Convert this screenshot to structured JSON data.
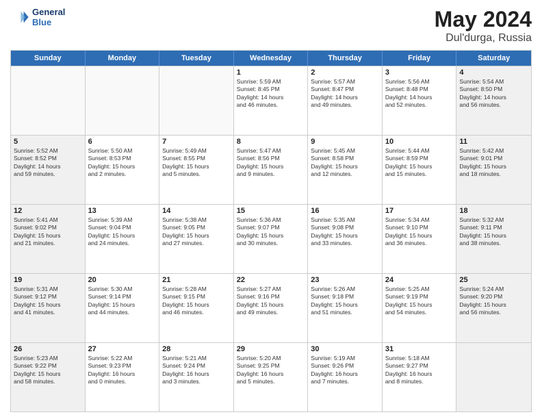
{
  "logo": {
    "line1": "General",
    "line2": "Blue"
  },
  "title": "May 2024",
  "location": "Dul'durga, Russia",
  "weekdays": [
    "Sunday",
    "Monday",
    "Tuesday",
    "Wednesday",
    "Thursday",
    "Friday",
    "Saturday"
  ],
  "rows": [
    [
      {
        "day": "",
        "info": "",
        "empty": true
      },
      {
        "day": "",
        "info": "",
        "empty": true
      },
      {
        "day": "",
        "info": "",
        "empty": true
      },
      {
        "day": "1",
        "info": "Sunrise: 5:59 AM\nSunset: 8:45 PM\nDaylight: 14 hours\nand 46 minutes."
      },
      {
        "day": "2",
        "info": "Sunrise: 5:57 AM\nSunset: 8:47 PM\nDaylight: 14 hours\nand 49 minutes."
      },
      {
        "day": "3",
        "info": "Sunrise: 5:56 AM\nSunset: 8:48 PM\nDaylight: 14 hours\nand 52 minutes."
      },
      {
        "day": "4",
        "info": "Sunrise: 5:54 AM\nSunset: 8:50 PM\nDaylight: 14 hours\nand 56 minutes.",
        "shaded": true
      }
    ],
    [
      {
        "day": "5",
        "info": "Sunrise: 5:52 AM\nSunset: 8:52 PM\nDaylight: 14 hours\nand 59 minutes.",
        "shaded": true
      },
      {
        "day": "6",
        "info": "Sunrise: 5:50 AM\nSunset: 8:53 PM\nDaylight: 15 hours\nand 2 minutes."
      },
      {
        "day": "7",
        "info": "Sunrise: 5:49 AM\nSunset: 8:55 PM\nDaylight: 15 hours\nand 5 minutes."
      },
      {
        "day": "8",
        "info": "Sunrise: 5:47 AM\nSunset: 8:56 PM\nDaylight: 15 hours\nand 9 minutes."
      },
      {
        "day": "9",
        "info": "Sunrise: 5:45 AM\nSunset: 8:58 PM\nDaylight: 15 hours\nand 12 minutes."
      },
      {
        "day": "10",
        "info": "Sunrise: 5:44 AM\nSunset: 8:59 PM\nDaylight: 15 hours\nand 15 minutes."
      },
      {
        "day": "11",
        "info": "Sunrise: 5:42 AM\nSunset: 9:01 PM\nDaylight: 15 hours\nand 18 minutes.",
        "shaded": true
      }
    ],
    [
      {
        "day": "12",
        "info": "Sunrise: 5:41 AM\nSunset: 9:02 PM\nDaylight: 15 hours\nand 21 minutes.",
        "shaded": true
      },
      {
        "day": "13",
        "info": "Sunrise: 5:39 AM\nSunset: 9:04 PM\nDaylight: 15 hours\nand 24 minutes."
      },
      {
        "day": "14",
        "info": "Sunrise: 5:38 AM\nSunset: 9:05 PM\nDaylight: 15 hours\nand 27 minutes."
      },
      {
        "day": "15",
        "info": "Sunrise: 5:36 AM\nSunset: 9:07 PM\nDaylight: 15 hours\nand 30 minutes."
      },
      {
        "day": "16",
        "info": "Sunrise: 5:35 AM\nSunset: 9:08 PM\nDaylight: 15 hours\nand 33 minutes."
      },
      {
        "day": "17",
        "info": "Sunrise: 5:34 AM\nSunset: 9:10 PM\nDaylight: 15 hours\nand 36 minutes."
      },
      {
        "day": "18",
        "info": "Sunrise: 5:32 AM\nSunset: 9:11 PM\nDaylight: 15 hours\nand 38 minutes.",
        "shaded": true
      }
    ],
    [
      {
        "day": "19",
        "info": "Sunrise: 5:31 AM\nSunset: 9:12 PM\nDaylight: 15 hours\nand 41 minutes.",
        "shaded": true
      },
      {
        "day": "20",
        "info": "Sunrise: 5:30 AM\nSunset: 9:14 PM\nDaylight: 15 hours\nand 44 minutes."
      },
      {
        "day": "21",
        "info": "Sunrise: 5:28 AM\nSunset: 9:15 PM\nDaylight: 15 hours\nand 46 minutes."
      },
      {
        "day": "22",
        "info": "Sunrise: 5:27 AM\nSunset: 9:16 PM\nDaylight: 15 hours\nand 49 minutes."
      },
      {
        "day": "23",
        "info": "Sunrise: 5:26 AM\nSunset: 9:18 PM\nDaylight: 15 hours\nand 51 minutes."
      },
      {
        "day": "24",
        "info": "Sunrise: 5:25 AM\nSunset: 9:19 PM\nDaylight: 15 hours\nand 54 minutes."
      },
      {
        "day": "25",
        "info": "Sunrise: 5:24 AM\nSunset: 9:20 PM\nDaylight: 15 hours\nand 56 minutes.",
        "shaded": true
      }
    ],
    [
      {
        "day": "26",
        "info": "Sunrise: 5:23 AM\nSunset: 9:22 PM\nDaylight: 15 hours\nand 58 minutes.",
        "shaded": true
      },
      {
        "day": "27",
        "info": "Sunrise: 5:22 AM\nSunset: 9:23 PM\nDaylight: 16 hours\nand 0 minutes."
      },
      {
        "day": "28",
        "info": "Sunrise: 5:21 AM\nSunset: 9:24 PM\nDaylight: 16 hours\nand 3 minutes."
      },
      {
        "day": "29",
        "info": "Sunrise: 5:20 AM\nSunset: 9:25 PM\nDaylight: 16 hours\nand 5 minutes."
      },
      {
        "day": "30",
        "info": "Sunrise: 5:19 AM\nSunset: 9:26 PM\nDaylight: 16 hours\nand 7 minutes."
      },
      {
        "day": "31",
        "info": "Sunrise: 5:18 AM\nSunset: 9:27 PM\nDaylight: 16 hours\nand 8 minutes."
      },
      {
        "day": "",
        "info": "",
        "empty": true,
        "shaded": true
      }
    ]
  ]
}
